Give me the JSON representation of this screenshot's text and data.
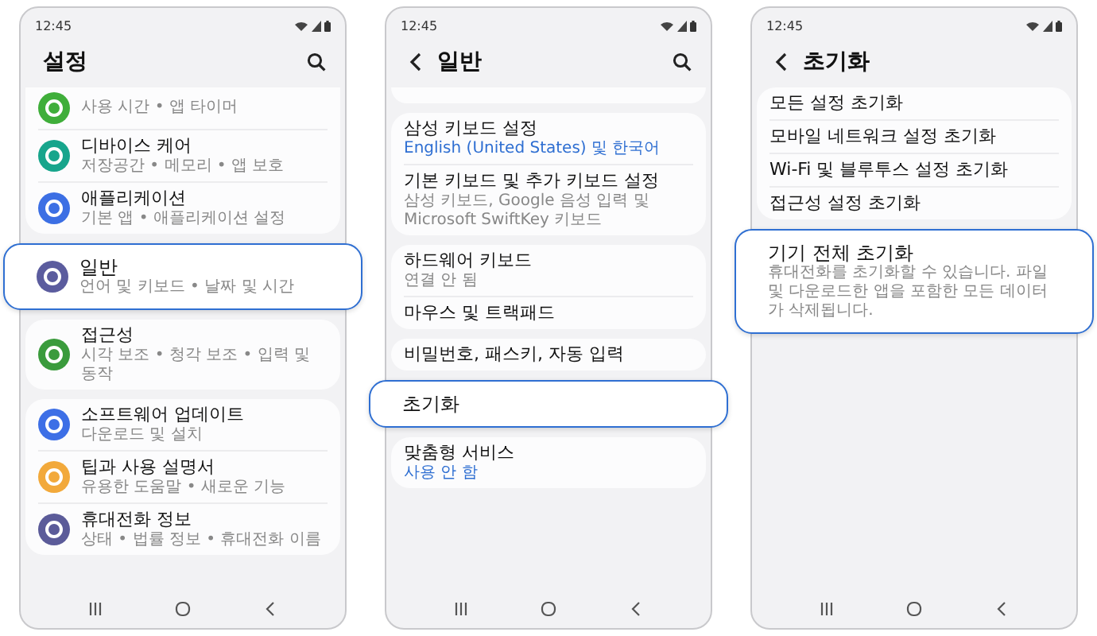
{
  "phones": [
    {
      "status_time": "12:45",
      "header": {
        "title": "설정",
        "back": false,
        "search": true
      },
      "groups": [
        {
          "kind": "partial-card",
          "items": [
            {
              "subtitle": "사용 시간 • 앱 타이머",
              "accent": false,
              "color": "#3fae3a"
            },
            {
              "title": "디바이스 케어",
              "subtitle": "저장공간 • 메모리 • 앱 보호",
              "accent": false,
              "color": "#17a58c"
            },
            {
              "title": "애플리케이션",
              "subtitle": "기본 앱 • 애플리케이션 설정",
              "accent": false,
              "color": "#3c6fe4"
            }
          ]
        },
        {
          "kind": "callout",
          "items": [
            {
              "title": "일반",
              "subtitle": "언어 및 키보드 • 날짜 및 시간",
              "accent": false,
              "color": "#5b5c9e"
            }
          ]
        },
        {
          "kind": "card",
          "items": [
            {
              "title": "접근성",
              "subtitle": "시각 보조 • 청각 보조 • 입력 및 동작",
              "accent": false,
              "color": "#3a9b3c"
            }
          ]
        },
        {
          "kind": "card",
          "items": [
            {
              "title": "소프트웨어 업데이트",
              "subtitle": "다운로드 및 설치",
              "accent": false,
              "color": "#3d6fe6"
            },
            {
              "title": "팁과 사용 설명서",
              "subtitle": "유용한 도움말 • 새로운 기능",
              "accent": false,
              "color": "#f2a93b"
            },
            {
              "title": "휴대전화 정보",
              "subtitle": "상태 • 법률 정보 • 휴대전화 이름",
              "accent": false,
              "color": "#5b5b99"
            }
          ]
        }
      ]
    },
    {
      "status_time": "12:45",
      "header": {
        "title": "일반",
        "back": true,
        "search": true
      },
      "groups": [
        {
          "kind": "partial-card"
        },
        {
          "kind": "card",
          "items": [
            {
              "title": "삼성 키보드 설정",
              "subtitle": "English (United States) 및 한국어",
              "accent": true
            },
            {
              "title": "기본 키보드 및 추가 키보드 설정",
              "subtitle": "삼성 키보드, Google 음성 입력 및 Microsoft SwiftKey 키보드",
              "accent": false
            }
          ]
        },
        {
          "kind": "card",
          "items": [
            {
              "title": "하드웨어 키보드",
              "subtitle": "연결 안 됨",
              "accent": false
            },
            {
              "title": "마우스 및 트랙패드"
            }
          ]
        },
        {
          "kind": "card",
          "items": [
            {
              "title": "비밀번호, 패스키, 자동 입력"
            }
          ]
        },
        {
          "kind": "callout",
          "items": [
            {
              "title": "초기화"
            }
          ]
        },
        {
          "kind": "card",
          "items": [
            {
              "title": "맞춤형 서비스",
              "subtitle": "사용 안 함",
              "accent": true
            }
          ]
        }
      ]
    },
    {
      "status_time": "12:45",
      "header": {
        "title": "초기화",
        "back": true,
        "search": false
      },
      "groups": [
        {
          "kind": "card",
          "items": [
            {
              "title": "모든 설정 초기화"
            },
            {
              "title": "모바일 네트워크 설정 초기화"
            },
            {
              "title": "Wi-Fi 및 블루투스 설정 초기화"
            },
            {
              "title": "접근성 설정 초기화"
            }
          ]
        },
        {
          "kind": "callout",
          "items": [
            {
              "title": "기기 전체 초기화",
              "subtitle": "휴대전화를 초기화할 수 있습니다. 파일 및 다운로드한 앱을 포함한 모든 데이터가 삭제됩니다.",
              "accent": false
            }
          ]
        }
      ]
    }
  ]
}
